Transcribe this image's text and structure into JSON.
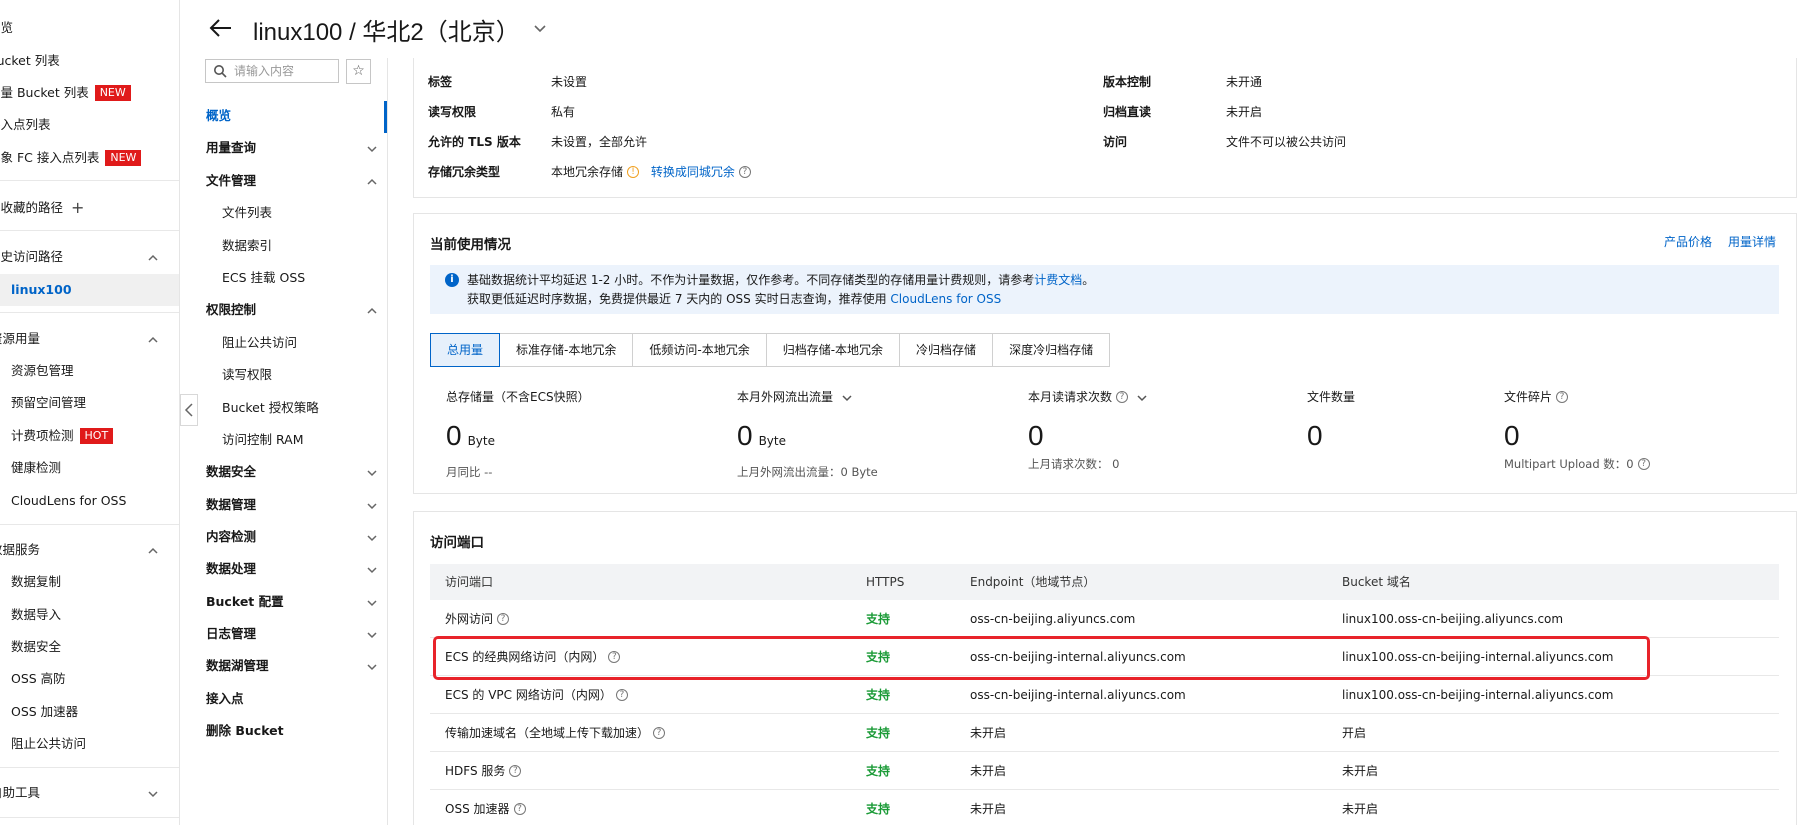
{
  "sidebar": {
    "items": [
      {
        "label": "概览"
      },
      {
        "label": "Bucket 列表"
      },
      {
        "label": "向量 Bucket 列表",
        "badge": "NEW"
      },
      {
        "label": "接入点列表"
      },
      {
        "label": "对象 FC 接入点列表",
        "badge": "NEW"
      }
    ],
    "favorites_label": "我收藏的路径",
    "history": {
      "label": "历史访问路径",
      "items": [
        {
          "label": "linux100"
        }
      ]
    },
    "resources": {
      "label": "资源用量",
      "items": [
        {
          "label": "资源包管理"
        },
        {
          "label": "预留空间管理"
        },
        {
          "label": "计费项检测",
          "badge": "HOT"
        },
        {
          "label": "健康检测"
        },
        {
          "label": "CloudLens for OSS"
        }
      ]
    },
    "data_services": {
      "label": "数据服务",
      "items": [
        {
          "label": "数据复制"
        },
        {
          "label": "数据导入"
        },
        {
          "label": "数据安全"
        },
        {
          "label": "OSS 高防"
        },
        {
          "label": "OSS 加速器"
        },
        {
          "label": "阻止公共访问"
        }
      ]
    },
    "self_help": {
      "label": "自助工具"
    }
  },
  "header": {
    "title": "linux100 / 华北2（北京）"
  },
  "bucket_nav": {
    "search_placeholder": "请输入内容",
    "items": [
      {
        "label": "概览",
        "level": 1,
        "active": true
      },
      {
        "label": "用量查询",
        "level": 1,
        "expand": "down"
      },
      {
        "label": "文件管理",
        "level": 1,
        "expand": "up"
      },
      {
        "label": "文件列表",
        "level": 2
      },
      {
        "label": "数据索引",
        "level": 2
      },
      {
        "label": "ECS 挂载 OSS",
        "level": 2
      },
      {
        "label": "权限控制",
        "level": 1,
        "expand": "up"
      },
      {
        "label": "阻止公共访问",
        "level": 2
      },
      {
        "label": "读写权限",
        "level": 2
      },
      {
        "label": "Bucket 授权策略",
        "level": 2
      },
      {
        "label": "访问控制 RAM",
        "level": 2
      },
      {
        "label": "数据安全",
        "level": 1,
        "expand": "down"
      },
      {
        "label": "数据管理",
        "level": 1,
        "expand": "down"
      },
      {
        "label": "内容检测",
        "level": 1,
        "expand": "down"
      },
      {
        "label": "数据处理",
        "level": 1,
        "expand": "down"
      },
      {
        "label": "Bucket 配置",
        "level": 1,
        "expand": "down"
      },
      {
        "label": "日志管理",
        "level": 1,
        "expand": "down"
      },
      {
        "label": "数据湖管理",
        "level": 1,
        "expand": "down"
      },
      {
        "label": "接入点",
        "level": 1
      },
      {
        "label": "删除 Bucket",
        "level": 1
      }
    ]
  },
  "basic_info": {
    "tags_label": "标签",
    "tags_value": "未设置",
    "acl_label": "读写权限",
    "acl_value": "私有",
    "tls_label": "允许的 TLS 版本",
    "tls_value": "未设置，全部允许",
    "redundancy_label": "存储冗余类型",
    "redundancy_value": "本地冗余存储",
    "redundancy_link": "转换成同城冗余",
    "versioning_label": "版本控制",
    "versioning_value": "未开通",
    "archive_label": "归档直读",
    "archive_value": "未开启",
    "access_label": "访问",
    "access_value": "文件不可以被公共访问"
  },
  "usage": {
    "title": "当前使用情况",
    "link_pricing": "产品价格",
    "link_details": "用量详情",
    "notice_line1_a": "基础数据统计平均延迟 1-2 小时。不作为计量数据，仅作参考。不同存储类型的存储用量计费规则，请参考",
    "notice_line1_link": "计费文档",
    "notice_line1_b": "。",
    "notice_line2_a": "获取更低延迟时序数据，免费提供最近 7 天内的 OSS 实时日志查询，推荐使用",
    "notice_line2_link": "CloudLens for OSS",
    "tabs": [
      "总用量",
      "标准存储-本地冗余",
      "低频访问-本地冗余",
      "归档存储-本地冗余",
      "冷归档存储",
      "深度冷归档存储"
    ],
    "stats": {
      "storage_label": "总存储量（不含ECS快照）",
      "storage_value": "0",
      "storage_unit": "Byte",
      "storage_sub": "月同比 --",
      "traffic_label": "本月外网流出流量",
      "traffic_value": "0",
      "traffic_unit": "Byte",
      "traffic_sub": "上月外网流出流量：0 Byte",
      "requests_label": "本月读请求次数",
      "requests_value": "0",
      "requests_sub": "上月请求次数：  0",
      "files_label": "文件数量",
      "files_value": "0",
      "fragments_label": "文件碎片",
      "fragments_value": "0",
      "fragments_sub": "Multipart Upload 数：0"
    }
  },
  "endpoints": {
    "title": "访问端口",
    "columns": [
      "访问端口",
      "HTTPS",
      "Endpoint（地域节点）",
      "Bucket 域名"
    ],
    "rows": [
      {
        "name": "外网访问",
        "https": "支持",
        "endpoint": "oss-cn-beijing.aliyuncs.com",
        "domain": "linux100.oss-cn-beijing.aliyuncs.com"
      },
      {
        "name": "ECS 的经典网络访问（内网）",
        "https": "支持",
        "endpoint": "oss-cn-beijing-internal.aliyuncs.com",
        "domain": "linux100.oss-cn-beijing-internal.aliyuncs.com"
      },
      {
        "name": "ECS 的 VPC 网络访问（内网）",
        "https": "支持",
        "endpoint": "oss-cn-beijing-internal.aliyuncs.com",
        "domain": "linux100.oss-cn-beijing-internal.aliyuncs.com"
      },
      {
        "name": "传输加速域名（全地域上传下载加速）",
        "https": "支持",
        "endpoint": "未开启",
        "domain": "开启"
      },
      {
        "name": "HDFS 服务",
        "https": "支持",
        "endpoint": "未开启",
        "domain": "未开启"
      },
      {
        "name": "OSS 加速器",
        "https": "支持",
        "endpoint": "未开启",
        "domain": "未开启"
      }
    ]
  },
  "colors": {
    "accent": "#0064c8",
    "success": "#1a9a36",
    "danger": "#e8232a",
    "badge": "#e01a1a"
  }
}
